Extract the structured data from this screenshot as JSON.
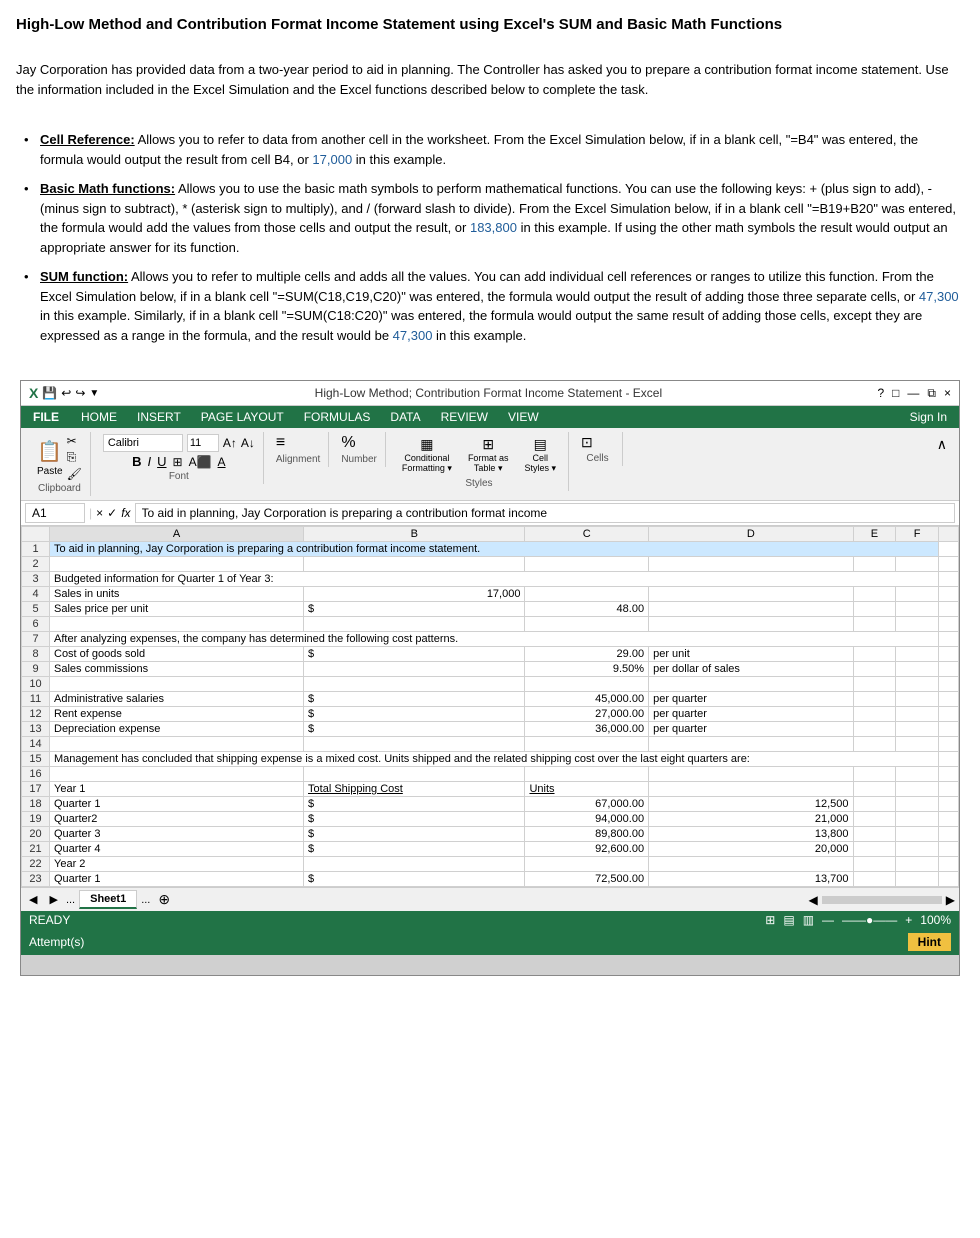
{
  "title": "High-Low Method and Contribution Format Income Statement using Excel's SUM and Basic Math Functions",
  "intro": "Jay Corporation has provided data from a two-year period to aid in planning.  The Controller has asked you to prepare a contribution format income statement.  Use the information included in the Excel Simulation and the Excel functions described below to complete the task.",
  "bullets": [
    {
      "term": "Cell Reference:",
      "text": "  Allows you to refer to data from another cell in the worksheet.  From the Excel Simulation below, if in a blank cell, \"=B4\" was entered, the formula would output the result from cell B4, or 17,000 in this example."
    },
    {
      "term": "Basic Math functions:",
      "text": "  Allows you to use the basic math symbols to perform mathematical functions.  You can use the following keys: + (plus sign to add), - (minus sign to subtract), * (asterisk sign to multiply), and / (forward slash to divide).  From the Excel Simulation below, if in a blank cell \"=B19+B20\" was entered, the formula would add the values from those cells and output the result, or 183,800 in this example.  If using the other math symbols the result would output an appropriate answer for its function."
    },
    {
      "term": "SUM function:",
      "text": "  Allows you to refer to multiple cells and adds all the values.  You can add individual cell references or ranges to utilize this function.  From the Excel Simulation below, if in a blank cell \"=SUM(C18,C19,C20)\" was entered, the formula would output the result of adding those three separate cells, or 47,300 in this example.  Similarly, if in a blank cell \"=SUM(C18:C20)\" was entered, the formula would output the same result of adding those cells, except they are expressed as a range in the formula, and the result would be 47,300 in this example."
    }
  ],
  "excel": {
    "titlebar": {
      "title": "High-Low Method; Contribution Format Income Statement - Excel",
      "controls": [
        "?",
        "□",
        "—",
        "⧉",
        "×"
      ]
    },
    "menubar": {
      "file": "FILE",
      "items": [
        "HOME",
        "INSERT",
        "PAGE LAYOUT",
        "FORMULAS",
        "DATA",
        "REVIEW",
        "VIEW"
      ],
      "signin": "Sign In"
    },
    "ribbon": {
      "clipboard_label": "Clipboard",
      "font_label": "Font",
      "font_name": "Calibri",
      "font_size": "11",
      "alignment_label": "Alignment",
      "number_label": "Number",
      "styles_label": "Styles",
      "cells_label": "Cells",
      "conditional_label": "Conditional\nFormatting",
      "format_table_label": "Format as\nTable",
      "cell_styles_label": "Cell\nStyles"
    },
    "formulabar": {
      "cell_ref": "A1",
      "formula": "To aid in planning, Jay Corporation is preparing a contribution format income"
    },
    "columns": [
      "A",
      "B",
      "C",
      "D",
      "E",
      "F"
    ],
    "rows": [
      {
        "num": 1,
        "a": "To aid in planning, Jay Corporation is preparing a contribution format income statement.",
        "b": "",
        "c": "",
        "d": "",
        "e": "",
        "f": ""
      },
      {
        "num": 2,
        "a": "",
        "b": "",
        "c": "",
        "d": "",
        "e": "",
        "f": ""
      },
      {
        "num": 3,
        "a": "Budgeted information for Quarter 1 of Year 3:",
        "b": "",
        "c": "",
        "d": "",
        "e": "",
        "f": ""
      },
      {
        "num": 4,
        "a": "Sales in units",
        "b": "17,000",
        "c": "",
        "d": "",
        "e": "",
        "f": ""
      },
      {
        "num": 5,
        "a": "Sales price per unit",
        "b": "$",
        "c": "48.00",
        "d": "",
        "e": "",
        "f": ""
      },
      {
        "num": 6,
        "a": "",
        "b": "",
        "c": "",
        "d": "",
        "e": "",
        "f": ""
      },
      {
        "num": 7,
        "a": "After analyzing expenses, the company has determined the following cost patterns.",
        "b": "",
        "c": "",
        "d": "",
        "e": "",
        "f": ""
      },
      {
        "num": 8,
        "a": "Cost of goods sold",
        "b": "$",
        "c": "29.00",
        "d": "per unit",
        "e": "",
        "f": ""
      },
      {
        "num": 9,
        "a": "Sales commissions",
        "b": "",
        "c": "9.50%",
        "d": "per dollar of sales",
        "e": "",
        "f": ""
      },
      {
        "num": 10,
        "a": "",
        "b": "",
        "c": "",
        "d": "",
        "e": "",
        "f": ""
      },
      {
        "num": 11,
        "a": "Administrative salaries",
        "b": "$",
        "c": "45,000.00",
        "d": "per quarter",
        "e": "",
        "f": ""
      },
      {
        "num": 12,
        "a": "Rent expense",
        "b": "$",
        "c": "27,000.00",
        "d": "per quarter",
        "e": "",
        "f": ""
      },
      {
        "num": 13,
        "a": "Depreciation expense",
        "b": "$",
        "c": "36,000.00",
        "d": "per quarter",
        "e": "",
        "f": ""
      },
      {
        "num": 14,
        "a": "",
        "b": "",
        "c": "",
        "d": "",
        "e": "",
        "f": ""
      },
      {
        "num": 15,
        "a": "Management has concluded that shipping expense is a mixed cost. Units shipped and the related shipping cost over the last eight quarters are:",
        "b": "",
        "c": "",
        "d": "",
        "e": "",
        "f": ""
      },
      {
        "num": 16,
        "a": "",
        "b": "",
        "c": "",
        "d": "",
        "e": "",
        "f": ""
      },
      {
        "num": 17,
        "a": "Year 1",
        "b": "Total Shipping Cost",
        "c": "Units",
        "d": "",
        "e": "",
        "f": ""
      },
      {
        "num": 18,
        "a": "  Quarter 1",
        "b": "$",
        "c": "67,000.00",
        "d": "12,500",
        "e": "",
        "f": ""
      },
      {
        "num": 19,
        "a": "  Quarter2",
        "b": "$",
        "c": "94,000.00",
        "d": "21,000",
        "e": "",
        "f": ""
      },
      {
        "num": 20,
        "a": "  Quarter 3",
        "b": "$",
        "c": "89,800.00",
        "d": "13,800",
        "e": "",
        "f": ""
      },
      {
        "num": 21,
        "a": "  Quarter 4",
        "b": "$",
        "c": "92,600.00",
        "d": "20,000",
        "e": "",
        "f": ""
      },
      {
        "num": 22,
        "a": "Year 2",
        "b": "",
        "c": "",
        "d": "",
        "e": "",
        "f": ""
      },
      {
        "num": 23,
        "a": "  Quarter 1",
        "b": "$",
        "c": "72,500.00",
        "d": "13,700",
        "e": "",
        "f": ""
      }
    ],
    "sheettabs": {
      "active": "Sheet1",
      "others": [
        "..."
      ]
    },
    "statusbar": {
      "status": "READY",
      "zoom": "100%"
    },
    "attempt": "Attempt(s)",
    "hint": "Hint"
  }
}
